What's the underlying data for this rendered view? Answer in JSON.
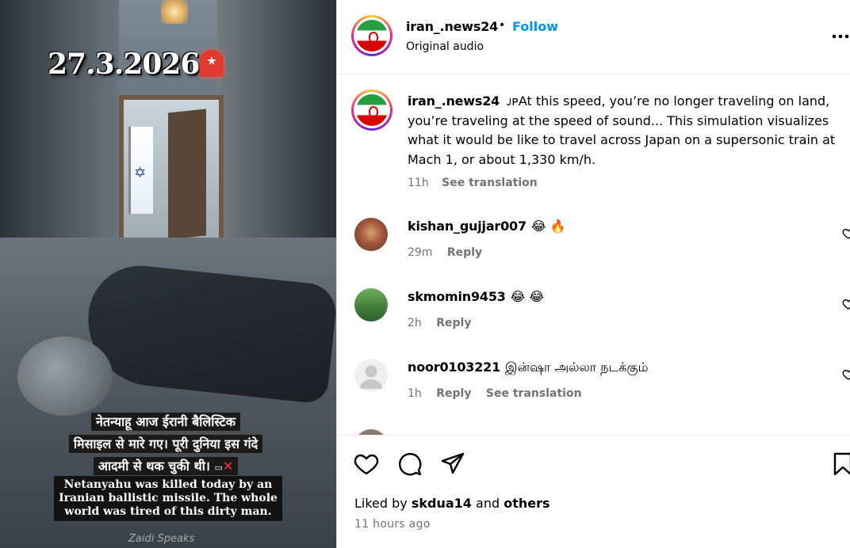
{
  "media": {
    "date_overlay": "27.3.2026",
    "caption_hindi_lines": [
      "नेतन्याहू आज ईरानी बैलिस्टिक",
      "मिसाइल से मारे गए। पूरी दुनिया इस गंदे",
      "आदमी से थक चुकी थी।"
    ],
    "caption_hindi_mark": "✕",
    "caption_english": "Netanyahu was killed today by an Iranian ballistic missile. The whole world was tired of this dirty man.",
    "watermark": "Zaidi Speaks"
  },
  "header": {
    "username": "iran_.news24",
    "separator": "•",
    "follow_label": "Follow",
    "audio_label": "Original audio",
    "more_label": "..."
  },
  "caption": {
    "username": "iran_.news24",
    "text": "ᴊᴘAt this speed, you’re no longer traveling on land, you’re traveling at the speed of sound... This simulation visualizes what it would be like to travel across Japan on a supersonic train at Mach 1, or about 1,330 km/h.",
    "time": "11h",
    "see_translation": "See translation"
  },
  "comments": [
    {
      "username": "kishan_gujjar007",
      "text": "😂 🔥",
      "time": "29m",
      "reply": "Reply",
      "see_translation": ""
    },
    {
      "username": "skmomin9453",
      "text": "😂 😂",
      "time": "2h",
      "reply": "Reply",
      "see_translation": ""
    },
    {
      "username": "noor0103221",
      "text": "இன்ஷா அல்லா நடக்கும்",
      "time": "1h",
      "reply": "Reply",
      "see_translation": "See translation"
    }
  ],
  "footer": {
    "liked_prefix": "Liked by",
    "liked_user": "skdua14",
    "liked_and": "and",
    "liked_others": "others",
    "timestamp": "11 hours ago"
  },
  "colors": {
    "accent": "#0095f6",
    "muted": "#737373",
    "divider": "#efefef"
  },
  "icons": [
    "heart-icon",
    "comment-icon",
    "share-icon",
    "bookmark-icon",
    "more-icon"
  ]
}
